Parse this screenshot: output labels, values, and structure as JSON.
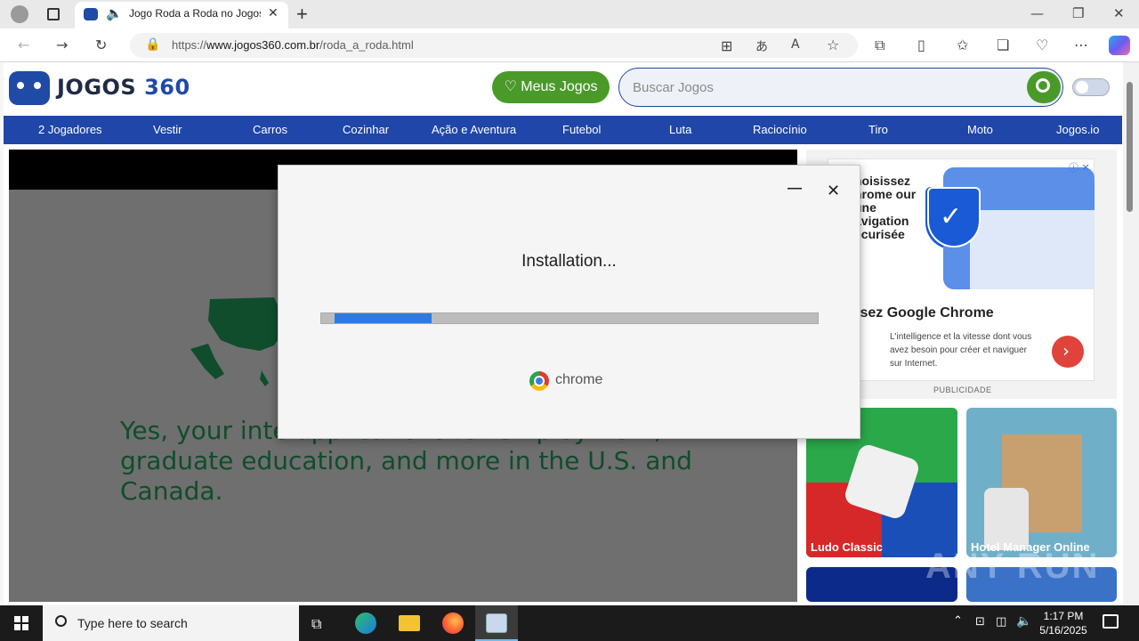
{
  "browser": {
    "tab_title": "Jogo Roda a Roda no Jogos",
    "url_prefix": "https://",
    "url_domain": "www.jogos360.com.br",
    "url_path": "/roda_a_roda.html",
    "new_tab_label": "+"
  },
  "site": {
    "logo_word1": "JOGOS",
    "logo_word2": "360",
    "meus_jogos_label": "Meus Jogos",
    "search_placeholder": "Buscar Jogos",
    "nav": [
      "2 Jogadores",
      "Vestir",
      "Carros",
      "Cozinhar",
      "Ação e Aventura",
      "Futebol",
      "Luta",
      "Raciocínio",
      "Tiro",
      "Moto",
      "Jogos.io"
    ]
  },
  "game": {
    "text": "Yes, your inte                              applications for employment, graduate education, and more in the U.S. and Canada."
  },
  "ad": {
    "headline": "hoisissez hrome our une avigation écurisée",
    "title": "isez Google Chrome",
    "body": "L'intelligence et la vitesse dont vous avez besoin pour créer et naviguer sur Internet.",
    "label": "PUBLICIDADE"
  },
  "tiles": [
    {
      "label": "Ludo Classic"
    },
    {
      "label": "Hotel Manager Online"
    }
  ],
  "dialog": {
    "title": "Installation...",
    "progress": 0.2,
    "brand": "chrome",
    "minimize": "—",
    "close": "✕"
  },
  "taskbar": {
    "search_placeholder": "Type here to search",
    "time": "1:17 PM",
    "date": "5/16/2025"
  },
  "watermark": "ANY RUN"
}
